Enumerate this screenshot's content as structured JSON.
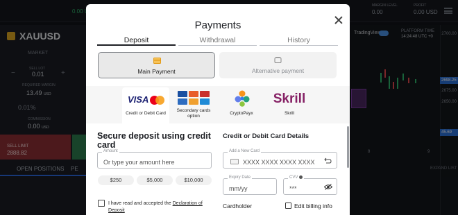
{
  "background_app": {
    "symbol": "XAUUSD",
    "market_label": "MARKET",
    "lot_label": "SELL LOT",
    "lot_value": "0.01",
    "required_margin_label": "REQUIRED MARGIN",
    "required_margin_value": "13.49",
    "required_margin_unit": "USD",
    "percent_value": "0.01%",
    "commission_label": "COMMISSION",
    "commission_value": "0.00",
    "commission_unit": "USD",
    "sell_limit_label": "SELL LIMIT",
    "sell_limit_price": "2888.82",
    "open_positions_tab": "OPEN POSITIONS",
    "pending_tab": "PE",
    "margin_level_label": "MARGIN LEVEL",
    "margin_level_value": "0.00",
    "profit_label": "PROFIT",
    "profit_value": "0.00 USD",
    "balance_value": "0.00 USD",
    "tradingview_label": "TradingView",
    "platform_time_label": "PLATFORM TIME",
    "platform_time_value": "14:24:48 UTC +0",
    "expand_label": "EXPAND LIST",
    "price_axis": [
      "2700.00",
      "2698.25",
      "2675.00",
      "2650.00",
      "45.69"
    ],
    "chart_x_labels": [
      "8",
      "9"
    ]
  },
  "modal": {
    "title": "Payments",
    "tabs": [
      {
        "label": "Deposit",
        "active": true
      },
      {
        "label": "Withdrawal",
        "active": false
      },
      {
        "label": "History",
        "active": false
      }
    ],
    "methods": [
      {
        "label": "Main Payment",
        "active": true,
        "icon": "card-icon"
      },
      {
        "label": "Alternative payment",
        "active": false,
        "icon": "wallet-icon"
      }
    ],
    "providers": [
      {
        "name": "Credit or Debit Card",
        "logo": "visa-mastercard-logo",
        "active": true
      },
      {
        "name": "Secondary cards option",
        "logo": "multi-card-logo",
        "active": false
      },
      {
        "name": "CryptoPayx",
        "logo": "crypto-logo",
        "active": false
      },
      {
        "name": "Skrill",
        "logo": "skrill-logo",
        "logo_text": "Skrill",
        "active": false
      }
    ],
    "visa_text": "VISA",
    "secure_title": "Secure deposit using credit card",
    "amount_caption": "Amount",
    "amount_placeholder": "Or type your amount here",
    "quick_amounts": [
      "$250",
      "$5,000",
      "$10,000"
    ],
    "card_section_title": "Credit or Debit Card Details",
    "new_card_caption": "Add a New Card",
    "card_number_placeholder": "XXXX XXXX XXXX XXXX",
    "expiry_caption": "Expiry Date",
    "expiry_placeholder": "mm/yy",
    "cvv_caption": "CVV",
    "cvv_value": "***",
    "agreement_text": "I have read and accepted the ",
    "agreement_link": "Declaration of Deposit",
    "cardholder_label": "Cardholder",
    "edit_billing_label": "Edit billing info",
    "accent_color": "#1d1f24",
    "skrill_color": "#862165"
  }
}
